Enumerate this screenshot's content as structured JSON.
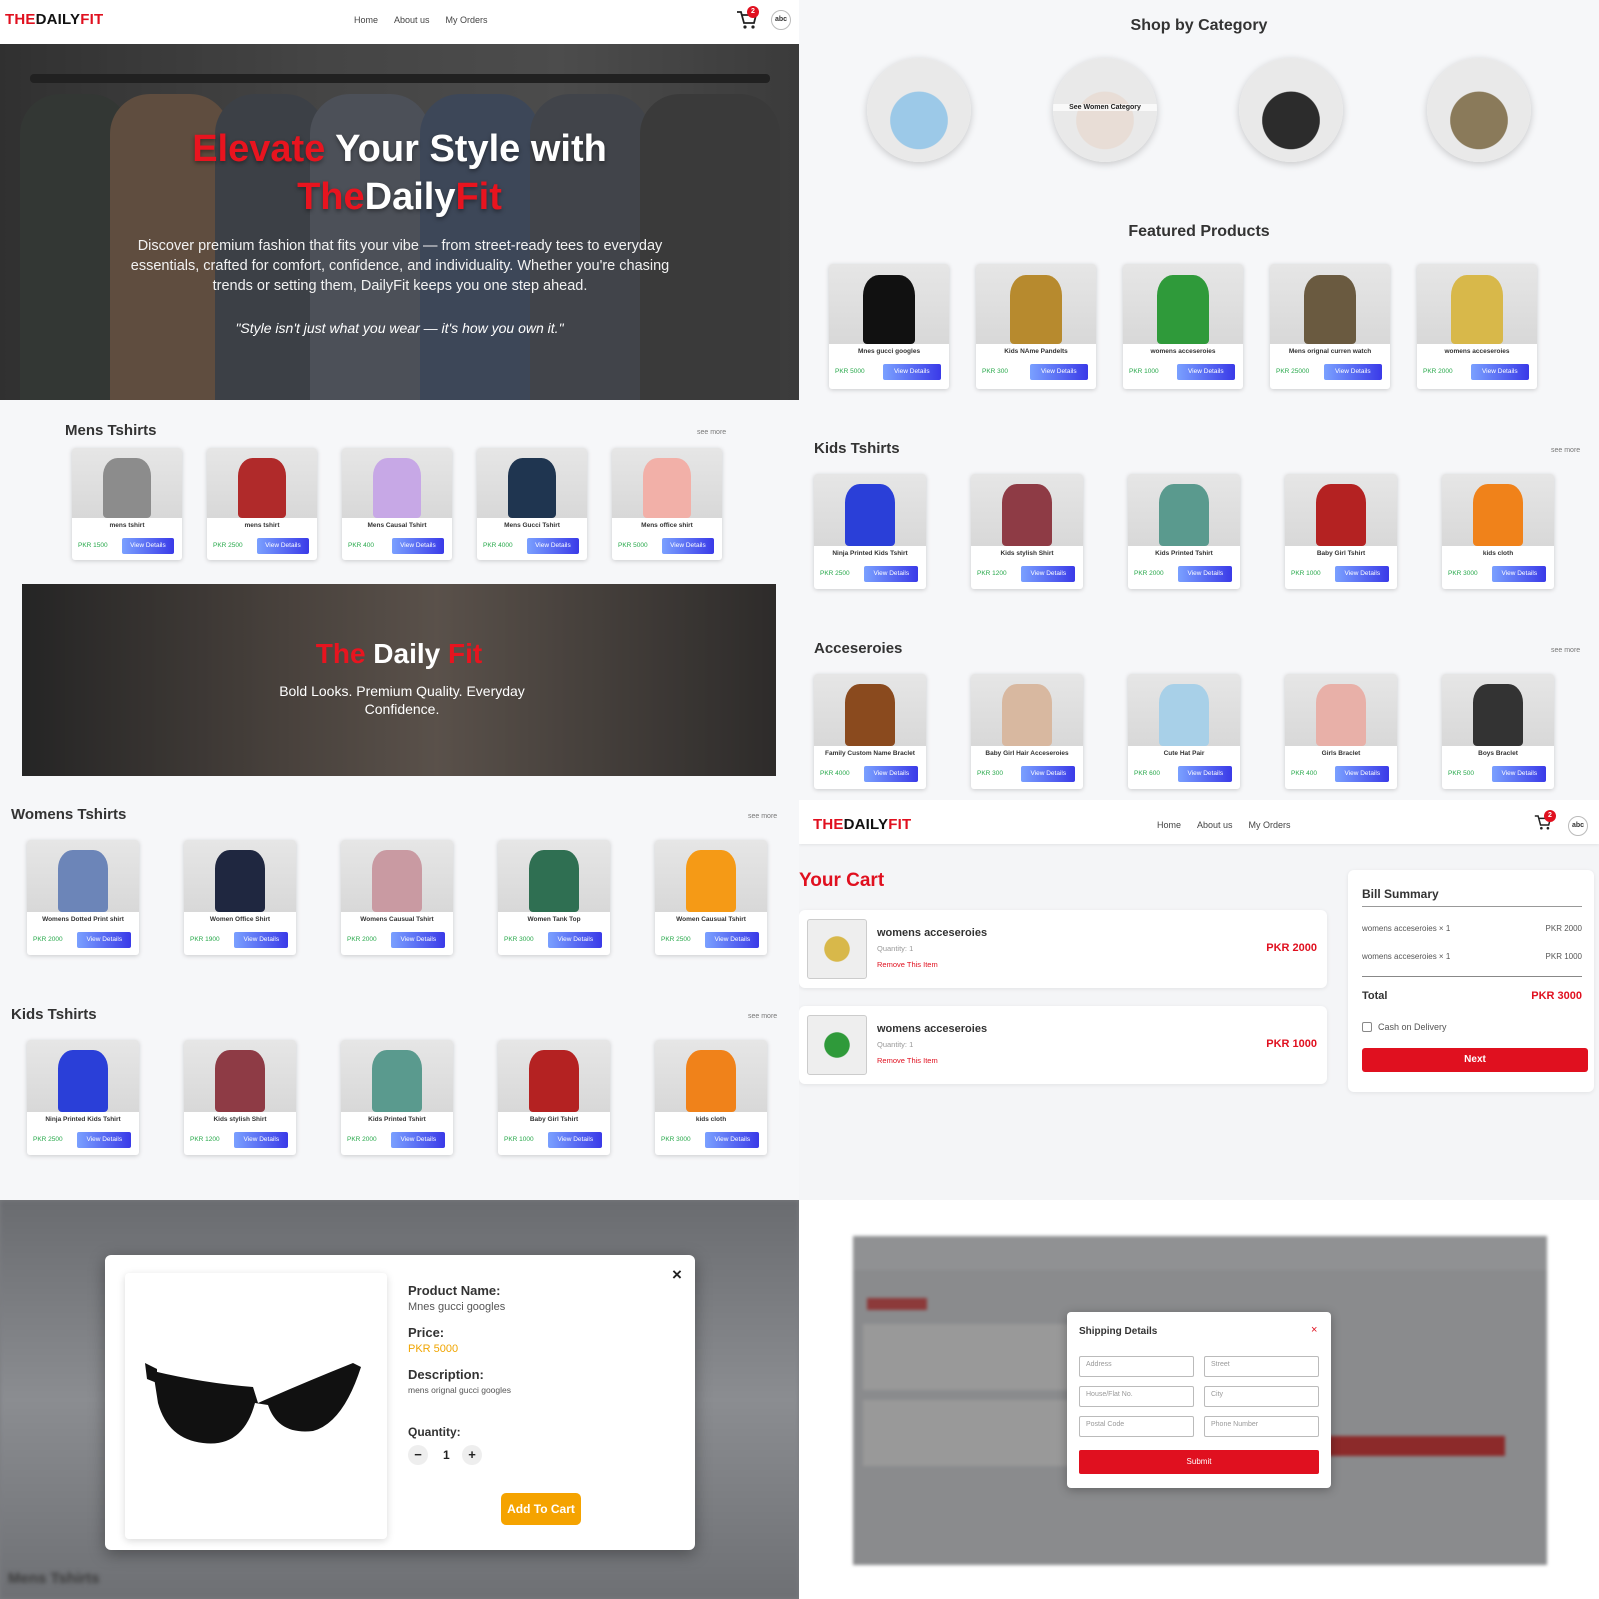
{
  "brand": {
    "part1": "THE",
    "part2": "DAILY",
    "part3": "FIT"
  },
  "nav": [
    "Home",
    "About us",
    "My Orders"
  ],
  "cart_count": "2",
  "avatar": "abc",
  "hero": {
    "w1": "Elevate",
    "w2": " Your Style with",
    "w3": "The",
    "w4": "Daily",
    "w5": "Fit",
    "desc": "Discover premium fashion that fits your vibe — from street-ready tees to everyday essentials, crafted for comfort, confidence, and individuality. Whether you're chasing trends or setting them, DailyFit keeps you one step ahead.",
    "quote": "\"Style isn't just what you wear — it's how you own it.\""
  },
  "see_more": "see more",
  "view_details": "View Details",
  "mens": {
    "title": "Mens Tshirts",
    "items": [
      {
        "name": "mens tshirt",
        "price": "PKR 1500",
        "color": "#8c8c8c"
      },
      {
        "name": "mens tshirt",
        "price": "PKR 2500",
        "color": "#b02a2a"
      },
      {
        "name": "Mens Causal Tshirt",
        "price": "PKR 400",
        "color": "#c7a8e6"
      },
      {
        "name": "Mens Gucci Tshirt",
        "price": "PKR 4000",
        "color": "#1f3550"
      },
      {
        "name": "Mens office shirt",
        "price": "PKR 5000",
        "color": "#f2b0a8"
      }
    ]
  },
  "banner": {
    "w1": "The",
    "w2": " Daily ",
    "w3": "Fit",
    "sub": "Bold Looks. Premium Quality. Everyday Confidence."
  },
  "womens": {
    "title": "Womens Tshirts",
    "items": [
      {
        "name": "Womens Dotted Print shirt",
        "price": "PKR 2000",
        "color": "#6c85b8"
      },
      {
        "name": "Women Office Shirt",
        "price": "PKR 1900",
        "color": "#1f2740"
      },
      {
        "name": "Womens Causual Tshirt",
        "price": "PKR 2000",
        "color": "#c99aa2"
      },
      {
        "name": "Women Tank Top",
        "price": "PKR 3000",
        "color": "#2f6f52"
      },
      {
        "name": "Women Causual Tshirt",
        "price": "PKR 2500",
        "color": "#f59a16"
      }
    ]
  },
  "kids_left": {
    "title": "Kids Tshirts",
    "items": [
      {
        "name": "Ninja Printed Kids Tshirt",
        "price": "PKR 2500",
        "color": "#2a3fd8"
      },
      {
        "name": "Kids stylish Shirt",
        "price": "PKR 1200",
        "color": "#8e3b45"
      },
      {
        "name": "Kids Printed Tshirt",
        "price": "PKR 2000",
        "color": "#5a9a8e"
      },
      {
        "name": "Baby Girl Tshirt",
        "price": "PKR 1000",
        "color": "#b42222"
      },
      {
        "name": "kids cloth",
        "price": "PKR 3000",
        "color": "#f0821a"
      }
    ]
  },
  "shop_by": {
    "title": "Shop by Category",
    "cat2_label": "See Women Category",
    "cats": [
      "#9cc9e8",
      "#e8ddd6",
      "#2c2c2c",
      "#8a7a5a"
    ]
  },
  "featured": {
    "title": "Featured Products",
    "items": [
      {
        "name": "Mnes gucci googles",
        "price": "PKR 5000",
        "color": "#111"
      },
      {
        "name": "Kids NAme Pandelts",
        "price": "PKR 300",
        "color": "#b78a2e"
      },
      {
        "name": "womens acceseroies",
        "price": "PKR 1000",
        "color": "#2f9a3a"
      },
      {
        "name": "Mens orignal curren watch",
        "price": "PKR 25000",
        "color": "#6a5a40"
      },
      {
        "name": "womens acceseroies",
        "price": "PKR 2000",
        "color": "#d8b84a"
      }
    ]
  },
  "kids_right": {
    "title": "Kids Tshirts",
    "items": [
      {
        "name": "Ninja Printed Kids Tshirt",
        "price": "PKR 2500",
        "color": "#2a3fd8"
      },
      {
        "name": "Kids stylish Shirt",
        "price": "PKR 1200",
        "color": "#8e3b45"
      },
      {
        "name": "Kids Printed Tshirt",
        "price": "PKR 2000",
        "color": "#5a9a8e"
      },
      {
        "name": "Baby Girl Tshirt",
        "price": "PKR 1000",
        "color": "#b42222"
      },
      {
        "name": "kids cloth",
        "price": "PKR 3000",
        "color": "#f0821a"
      }
    ]
  },
  "acc": {
    "title": "Acceseroies",
    "items": [
      {
        "name": "Family Custom Name Braclet",
        "price": "PKR 4000",
        "color": "#8a4a1e"
      },
      {
        "name": "Baby Girl Hair Acceseroies",
        "price": "PKR 300",
        "color": "#d8b8a0"
      },
      {
        "name": "Cute Hat Pair",
        "price": "PKR 600",
        "color": "#a8d0e8"
      },
      {
        "name": "Girls Braclet",
        "price": "PKR 400",
        "color": "#e8b0a8"
      },
      {
        "name": "Boys Braclet",
        "price": "PKR 500",
        "color": "#333"
      }
    ]
  },
  "cart": {
    "title": "Your Cart",
    "qty_label": "Quantity: 1",
    "remove": "Remove This Item",
    "items": [
      {
        "name": "womens acceseroies",
        "price": "PKR 2000",
        "color": "#d8b84a"
      },
      {
        "name": "womens acceseroies",
        "price": "PKR 1000",
        "color": "#2f9a3a"
      }
    ],
    "bill": {
      "title": "Bill Summary",
      "rows": [
        [
          "womens acceseroies × 1",
          "PKR 2000"
        ],
        [
          "womens acceseroies × 1",
          "PKR 1000"
        ]
      ],
      "total_label": "Total",
      "total": "PKR 3000",
      "cod": "Cash on Delivery",
      "next": "Next"
    }
  },
  "modal": {
    "name_label": "Product Name:",
    "name": "Mnes gucci googles",
    "price_label": "Price:",
    "price": "PKR 5000",
    "desc_label": "Description:",
    "desc": "mens orignal gucci googles",
    "qty_label": "Quantity:",
    "qty": "1",
    "minus": "−",
    "plus": "+",
    "add": "Add To Cart",
    "close": "×"
  },
  "shipping": {
    "title": "Shipping Details",
    "close": "×",
    "fields": [
      "Address",
      "Street",
      "House/Flat No.",
      "City",
      "Postal Code",
      "Phone Number"
    ],
    "submit": "Submit"
  },
  "blur_title": "Mens Tshirts",
  "colors": {
    "accent": "#e0101f",
    "gradient_end": "#3a3ae8",
    "price_green": "#27a84a",
    "gold": "#f0a500"
  }
}
